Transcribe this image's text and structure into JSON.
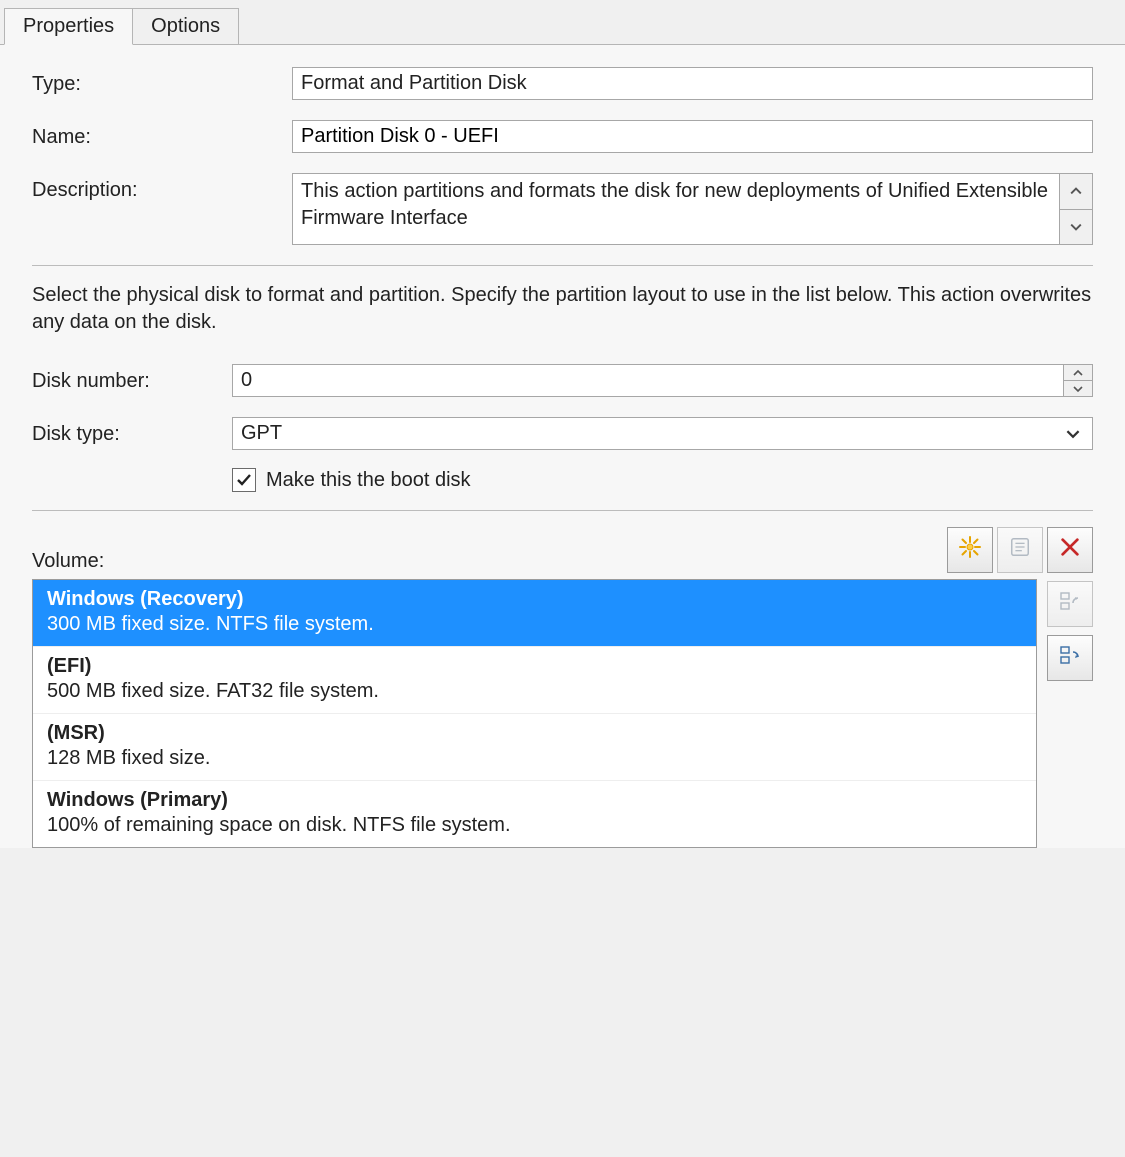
{
  "tabs": {
    "properties": "Properties",
    "options": "Options"
  },
  "labels": {
    "type": "Type:",
    "name": "Name:",
    "description": "Description:",
    "disk_number": "Disk number:",
    "disk_type": "Disk type:",
    "volume": "Volume:"
  },
  "fields": {
    "type_value": "Format and Partition Disk",
    "name_value": "Partition Disk 0 - UEFI",
    "description_value": "This action partitions and formats the disk for new deployments of Unified Extensible Firmware Interface",
    "disk_number_value": "0",
    "disk_type_value": "GPT"
  },
  "instruction": "Select the physical disk to format and partition. Specify the partition layout to use in the list below. This action overwrites any data on the disk.",
  "checkbox": {
    "boot_label": "Make this the boot disk",
    "boot_checked": true
  },
  "volumes": [
    {
      "title": "Windows (Recovery)",
      "subtitle": "300 MB fixed size. NTFS file system.",
      "selected": true
    },
    {
      "title": "(EFI)",
      "subtitle": "500 MB fixed size. FAT32 file system.",
      "selected": false
    },
    {
      "title": "(MSR)",
      "subtitle": "128 MB fixed size.",
      "selected": false
    },
    {
      "title": "Windows (Primary)",
      "subtitle": "100% of remaining space on disk. NTFS file system.",
      "selected": false
    }
  ]
}
